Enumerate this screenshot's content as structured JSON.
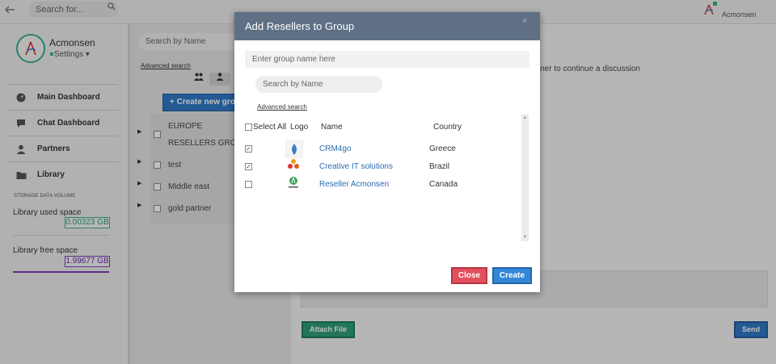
{
  "topbar": {
    "search_placeholder": "Search for...",
    "username": "Acmonsen"
  },
  "sidebar": {
    "user_name": "Acmonsen",
    "settings_label": "Settings",
    "nav": [
      {
        "label": "Main Dashboard",
        "icon": "gauge-icon"
      },
      {
        "label": "Chat Dashboard",
        "icon": "chat-icon"
      },
      {
        "label": "Partners",
        "icon": "person-icon"
      },
      {
        "label": "Library",
        "icon": "folder-icon"
      }
    ],
    "storage_title": "STORAGE DATA VOLUME",
    "used_label": "Library used space",
    "used_value": "0.00323 GB",
    "free_label": "Library free space",
    "free_value": "1.99677 GB",
    "colors": {
      "used": "#39b089",
      "free": "#7a3fb8"
    }
  },
  "groups_panel": {
    "search_placeholder": "Search by Name",
    "advanced_search": "Advanced search",
    "create_button": "Create new grou",
    "groups": [
      {
        "label_line1": "EUROPE",
        "label_line2": "RESELLERS GROUP"
      },
      {
        "label": "test"
      },
      {
        "label": "Middle east"
      },
      {
        "label": "gold partner"
      }
    ]
  },
  "main": {
    "partner_hint": "rtner to continue a discussion",
    "attach_button": "Attach File",
    "send_button": "Send"
  },
  "modal": {
    "title": "Add Resellers to Group",
    "close_x": "×",
    "group_name_placeholder": "Enter group name here",
    "search_placeholder": "Search by Name",
    "advanced_search": "Advanced search",
    "columns": {
      "select_all": "Select All",
      "logo": "Logo",
      "name": "Name",
      "country": "Country"
    },
    "rows": [
      {
        "name": "CRM4go",
        "country": "Greece",
        "checked": true,
        "check_mark": "✓"
      },
      {
        "name": "Creative IT solutions",
        "country": "Brazil",
        "checked": true,
        "check_mark": "✓"
      },
      {
        "name": "Reseller Acmonsen",
        "country": "Canada",
        "checked": false,
        "check_mark": ""
      }
    ],
    "close_button": "Close",
    "create_button": "Create"
  }
}
